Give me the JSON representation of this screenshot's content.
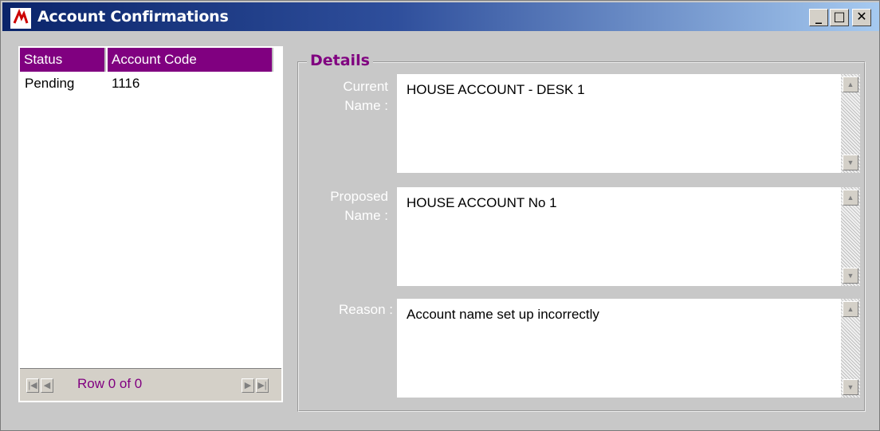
{
  "window": {
    "title": "Account Confirmations"
  },
  "table": {
    "columns": [
      "Status",
      "Account Code"
    ],
    "rows": [
      {
        "status": "Pending",
        "account_code": "1116"
      }
    ],
    "nav": {
      "row_info": "Row 0 of 0"
    }
  },
  "details": {
    "title": "Details",
    "current_name_label": "Current Name :",
    "current_name_value": "HOUSE ACCOUNT - DESK 1",
    "proposed_name_label": "Proposed Name :",
    "proposed_name_value": "HOUSE ACCOUNT No 1",
    "reason_label": "Reason :",
    "reason_value": "Account name set up incorrectly"
  },
  "colors": {
    "accent": "#800080",
    "title_bar": "#0a246a",
    "window_bg": "#c8c8c8"
  },
  "icons": [
    "app-logo-icon",
    "minimize-icon",
    "maximize-icon",
    "close-icon",
    "first-record-icon",
    "previous-record-icon",
    "next-record-icon",
    "last-record-icon",
    "scroll-up-icon",
    "scroll-down-icon"
  ]
}
